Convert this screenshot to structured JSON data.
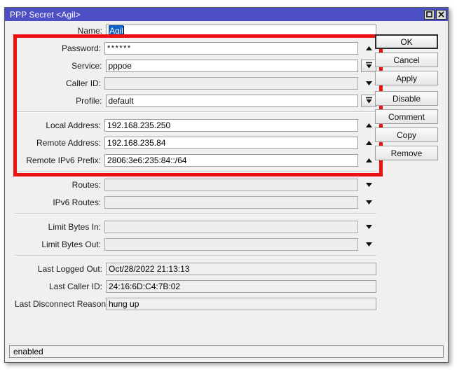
{
  "window": {
    "title": "PPP Secret <Agil>",
    "titlebar_color": "#4d50c4",
    "annotation_color": "#ee1111",
    "controls": [
      {
        "name": "maximize",
        "label": "Maximize"
      },
      {
        "name": "close",
        "label": "Close"
      }
    ]
  },
  "form": {
    "groups": [
      {
        "name": "credentials",
        "rows": [
          {
            "label": "Name:",
            "value": "Agil",
            "adorn": "none",
            "state": "selected"
          },
          {
            "label": "Password:",
            "value": "******",
            "adorn": "spin-up",
            "state": "editable"
          },
          {
            "label": "Service:",
            "value": "pppoe",
            "adorn": "dropdown",
            "state": "editable"
          },
          {
            "label": "Caller ID:",
            "value": "",
            "adorn": "chevron",
            "state": "disabled"
          },
          {
            "label": "Profile:",
            "value": "default",
            "adorn": "dropdown",
            "state": "editable"
          }
        ]
      },
      {
        "name": "addresses",
        "rows": [
          {
            "label": "Local Address:",
            "value": "192.168.235.250",
            "adorn": "spin-up",
            "state": "editable"
          },
          {
            "label": "Remote Address:",
            "value": "192.168.235.84",
            "adorn": "spin-up",
            "state": "editable"
          },
          {
            "label": "Remote IPv6 Prefix:",
            "value": "2806:3e6:235:84::/64",
            "adorn": "spin-up",
            "state": "editable"
          }
        ]
      },
      {
        "name": "routes",
        "rows": [
          {
            "label": "Routes:",
            "value": "",
            "adorn": "chevron",
            "state": "disabled"
          },
          {
            "label": "IPv6 Routes:",
            "value": "",
            "adorn": "chevron",
            "state": "disabled"
          }
        ]
      },
      {
        "name": "limits",
        "rows": [
          {
            "label": "Limit Bytes In:",
            "value": "",
            "adorn": "chevron",
            "state": "disabled"
          },
          {
            "label": "Limit Bytes Out:",
            "value": "",
            "adorn": "chevron",
            "state": "disabled"
          }
        ]
      },
      {
        "name": "last-session",
        "rows": [
          {
            "label": "Last Logged Out:",
            "value": "Oct/28/2022 21:13:13",
            "adorn": "none",
            "state": "readonly"
          },
          {
            "label": "Last Caller ID:",
            "value": "24:16:6D:C4:7B:02",
            "adorn": "none",
            "state": "readonly"
          },
          {
            "label": "Last Disconnect Reason:",
            "value": "hung up",
            "adorn": "none",
            "state": "readonly"
          }
        ]
      }
    ]
  },
  "buttons": [
    {
      "label": "OK",
      "focused": true,
      "gap": false
    },
    {
      "label": "Cancel",
      "focused": false,
      "gap": false
    },
    {
      "label": "Apply",
      "focused": false,
      "gap": false
    },
    {
      "label": "Disable",
      "focused": false,
      "gap": true
    },
    {
      "label": "Comment",
      "focused": false,
      "gap": false
    },
    {
      "label": "Copy",
      "focused": false,
      "gap": false
    },
    {
      "label": "Remove",
      "focused": false,
      "gap": false
    }
  ],
  "statusbar": {
    "text": "enabled"
  }
}
